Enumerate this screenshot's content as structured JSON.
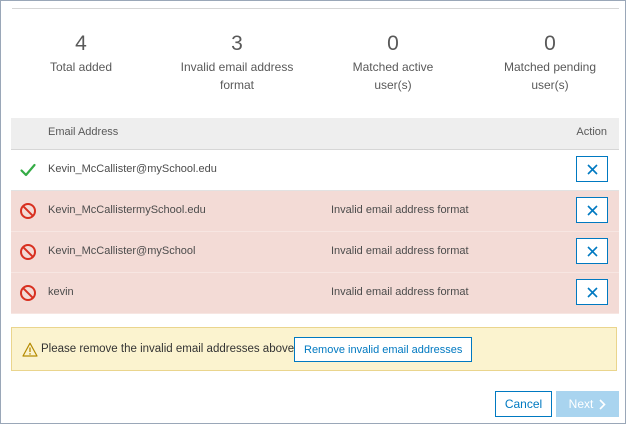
{
  "stats": [
    {
      "value": "4",
      "label": "Total added"
    },
    {
      "value": "3",
      "label": "Invalid email address format"
    },
    {
      "value": "0",
      "label": "Matched active user(s)"
    },
    {
      "value": "0",
      "label": "Matched pending user(s)"
    }
  ],
  "table": {
    "header_email": "Email Address",
    "header_action": "Action",
    "rows": [
      {
        "status": "valid",
        "status_icon": "checkmark-icon",
        "email": "Kevin_McCallister@mySchool.edu",
        "error": ""
      },
      {
        "status": "invalid",
        "status_icon": "prohibited-icon",
        "email": "Kevin_McCallistermySchool.edu",
        "error": "Invalid email address format"
      },
      {
        "status": "invalid",
        "status_icon": "prohibited-icon",
        "email": "Kevin_McCallister@mySchool",
        "error": "Invalid email address format"
      },
      {
        "status": "invalid",
        "status_icon": "prohibited-icon",
        "email": "kevin",
        "error": "Invalid email address format"
      }
    ],
    "remove_icon": "close-icon"
  },
  "banner": {
    "icon": "warning-icon",
    "message": "Please remove the invalid email addresses above.",
    "button_label": "Remove invalid email addresses"
  },
  "footer": {
    "cancel_label": "Cancel",
    "next_label": "Next",
    "next_icon": "chevron-right-icon"
  },
  "colors": {
    "accent": "#0079c1",
    "valid_check": "#35ac46",
    "invalid_icon": "#d83020",
    "invalid_row": "#f3dbd6",
    "warning_bg": "#fbf3cf",
    "next_disabled": "#a9d4ef"
  }
}
